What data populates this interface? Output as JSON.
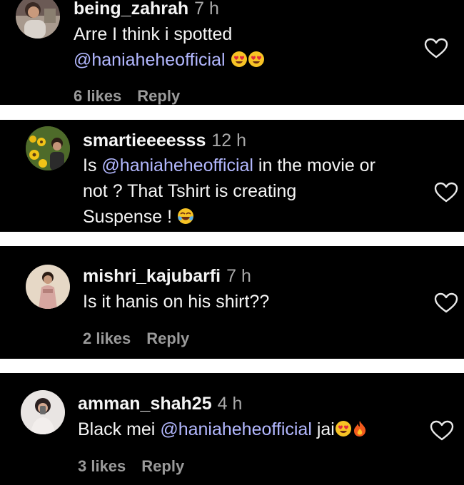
{
  "comments": [
    {
      "username": "being_zahrah",
      "time": "7 h",
      "line1": "Arre I think i spotted",
      "mention": "@haniaheheofficial",
      "likes": "6 likes",
      "reply": "Reply",
      "emojis": [
        "heart-eyes",
        "heart-eyes"
      ]
    },
    {
      "username": "smartieeeesss",
      "time": "12 h",
      "prefix": "Is ",
      "mention": "@haniaheheofficial",
      "line1_rest": " in the movie or",
      "line2": "not ? That Tshirt is creating",
      "line3": "Suspense ! ",
      "emojis": [
        "tears-of-joy"
      ]
    },
    {
      "username": "mishri_kajubarfi",
      "time": "7 h",
      "line1": "Is it hanis on his shirt??",
      "likes": "2 likes",
      "reply": "Reply"
    },
    {
      "username": "amman_shah25",
      "time": "4 h",
      "prefix": "Black mei ",
      "mention": "@haniaheheofficial",
      "suffix": " jai",
      "likes": "3 likes",
      "reply": "Reply",
      "emojis": [
        "heart-eyes",
        "fire"
      ]
    }
  ],
  "colors": {
    "background": "#000000",
    "text": "#f5f5f5",
    "muted": "#a8a8a8",
    "mention": "#b3b8ff",
    "separator": "#ffffff"
  },
  "icons": [
    "heart-outline-icon",
    "heart-eyes-emoji",
    "tears-of-joy-emoji",
    "fire-emoji"
  ]
}
